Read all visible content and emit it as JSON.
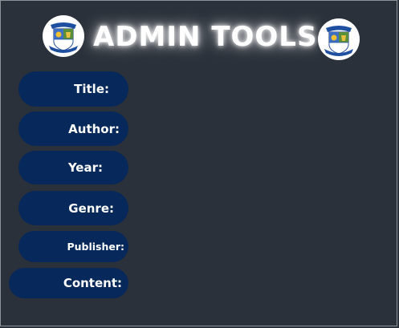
{
  "header": {
    "title": "ADMIN TOOLS",
    "logo_left_icon": "school-crest-icon",
    "logo_right_icon": "school-crest-icon"
  },
  "fields": [
    {
      "label": "Title:"
    },
    {
      "label": "Author:"
    },
    {
      "label": "Year:"
    },
    {
      "label": "Genre:"
    },
    {
      "label": "Publisher:"
    },
    {
      "label": "Content:"
    }
  ],
  "colors": {
    "background": "#2b313a",
    "button": "#06285a",
    "text": "#ffffff"
  }
}
